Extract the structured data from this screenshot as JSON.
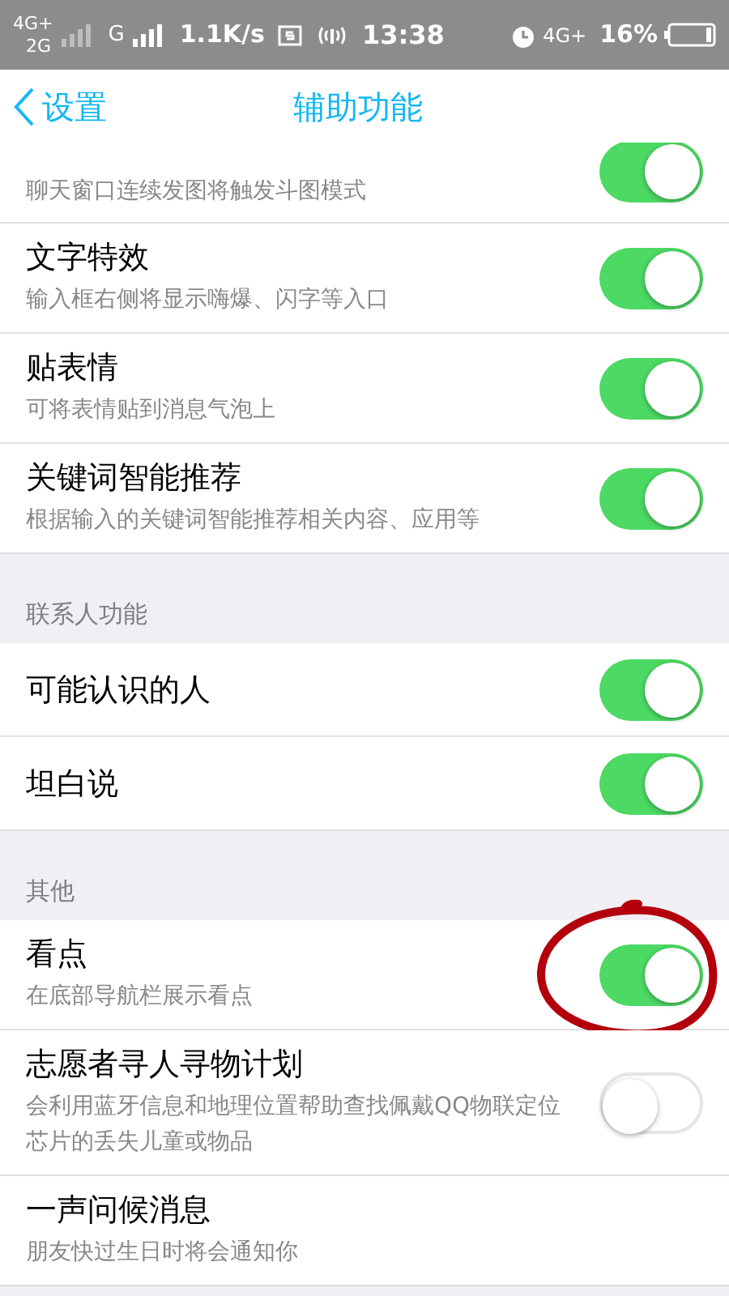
{
  "status_bar": {
    "network_1": "4G+",
    "network_2": "2G",
    "network_3": "G",
    "speed": "1.1K/s",
    "time": "13:38",
    "network_4": "4G+",
    "battery": "16%"
  },
  "header": {
    "back": "设置",
    "title": "辅助功能"
  },
  "sections": [
    {
      "items": [
        {
          "subtitle": "聊天窗口连续发图将触发斗图模式",
          "on": true,
          "cut": true
        },
        {
          "title": "文字特效",
          "subtitle": "输入框右侧将显示嗨爆、闪字等入口",
          "on": true
        },
        {
          "title": "贴表情",
          "subtitle": "可将表情贴到消息气泡上",
          "on": true
        },
        {
          "title": "关键词智能推荐",
          "subtitle": "根据输入的关键词智能推荐相关内容、应用等",
          "on": true
        }
      ]
    },
    {
      "header": "联系人功能",
      "items": [
        {
          "title": "可能认识的人",
          "on": true
        },
        {
          "title": "坦白说",
          "on": true
        }
      ]
    },
    {
      "header": "其他",
      "items": [
        {
          "title": "看点",
          "subtitle": "在底部导航栏展示看点",
          "on": true,
          "circled": true
        },
        {
          "title": "志愿者寻人寻物计划",
          "subtitle": "会利用蓝牙信息和地理位置帮助查找佩戴QQ物联定位芯片的丢失儿童或物品",
          "on": false
        },
        {
          "title": "一声问候消息",
          "subtitle": "朋友快过生日时将会通知你"
        }
      ]
    }
  ]
}
